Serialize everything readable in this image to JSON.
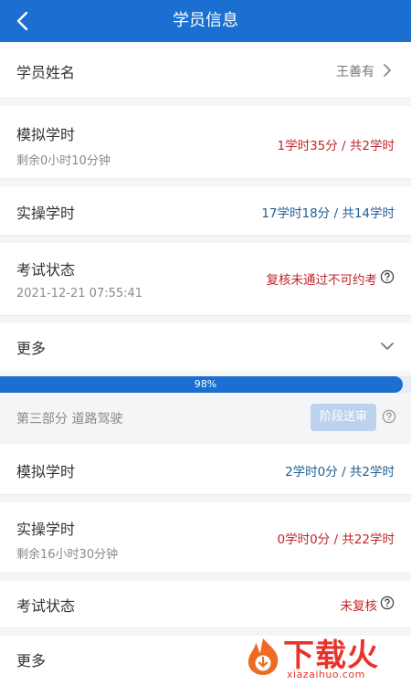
{
  "header": {
    "title": "学员信息"
  },
  "name_row": {
    "label": "学员姓名",
    "value": "王善有"
  },
  "sim_hours": {
    "label": "模拟学时",
    "sub": "剩余0小时10分钟",
    "value": "1学时35分 / 共2学时"
  },
  "prac_hours": {
    "label": "实操学时",
    "value": "17学时18分 / 共14学时"
  },
  "exam": {
    "label": "考试状态",
    "sub": "2021-12-21 07:55:41",
    "value": "复核未通过不可约考"
  },
  "more1": {
    "label": "更多"
  },
  "progress": {
    "text": "98%",
    "value": 0.98
  },
  "section": {
    "title": "第三部分 道路驾驶",
    "button": "阶段送审"
  },
  "sim_hours2": {
    "label": "模拟学时",
    "value": "2学时0分 / 共2学时"
  },
  "prac_hours2": {
    "label": "实操学时",
    "sub": "剩余16小时30分钟",
    "value": "0学时0分 / 共22学时"
  },
  "exam2": {
    "label": "考试状态",
    "value": "未复核"
  },
  "more2": {
    "label": "更多"
  },
  "watermark": {
    "text": "下载火",
    "sub": "xiazaihuo.com"
  },
  "colors": {
    "primary": "#1a6fd0",
    "red": "#c0242b",
    "blue": "#1d5f95"
  }
}
